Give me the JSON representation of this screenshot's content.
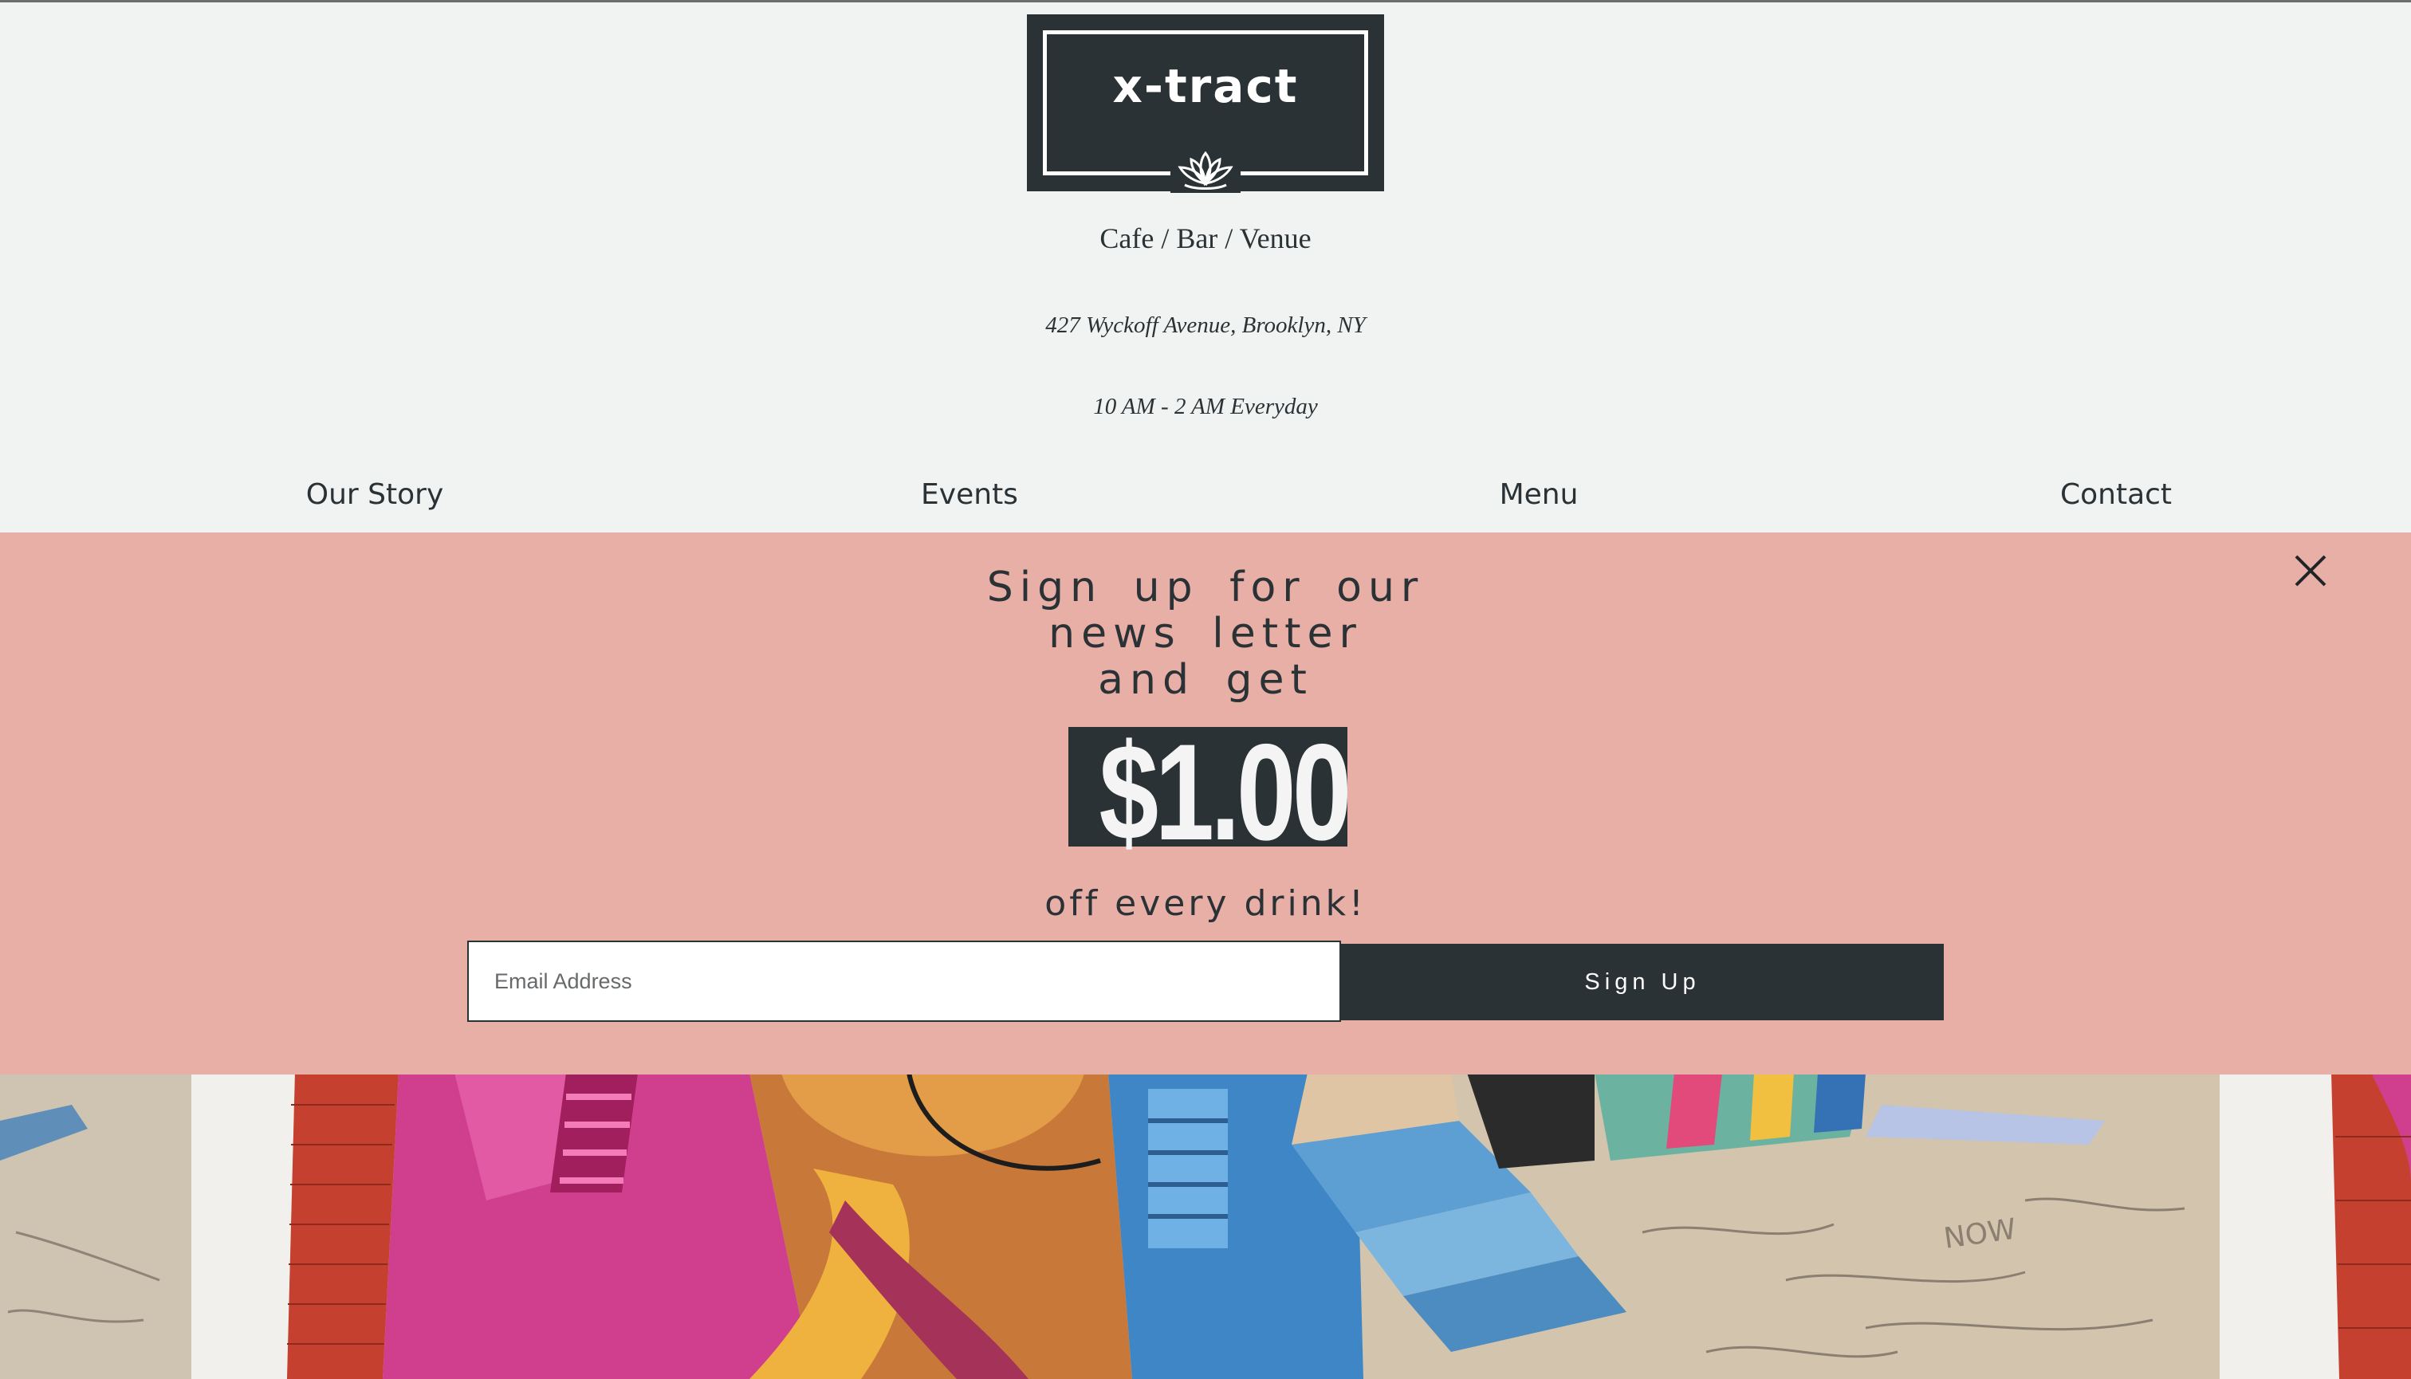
{
  "header": {
    "logo_text": "x-tract",
    "tagline": "Cafe / Bar / Venue",
    "address": "427 Wyckoff Avenue, Brooklyn, NY",
    "hours": "10 AM - 2 AM Everyday"
  },
  "nav": {
    "items": [
      {
        "label": "Our Story"
      },
      {
        "label": "Events"
      },
      {
        "label": "Menu"
      },
      {
        "label": "Contact"
      }
    ]
  },
  "popup": {
    "headline_lines": [
      "Sign up for our",
      "news letter",
      "and get"
    ],
    "price": "$1.00",
    "subtext": "off every drink!",
    "email_placeholder": "Email Address",
    "signup_label": "Sign Up"
  },
  "colors": {
    "page_bg": "#f1f3f2",
    "dark": "#2a3236",
    "popup_bg": "#e8afa7"
  },
  "icons": {
    "logo": "lotus-icon",
    "close": "close-icon"
  }
}
